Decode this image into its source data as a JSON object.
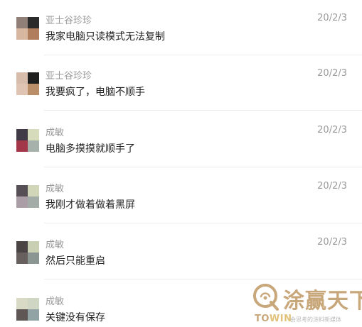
{
  "messages": [
    {
      "name": "亚士谷珍珍",
      "date": "20/2/3",
      "text": "我家电脑只读模式无法复制",
      "avatar_colors": [
        "#8f7f77",
        "#2b2b2b",
        "#d7b79f",
        "#b07e5c"
      ]
    },
    {
      "name": "亚士谷珍珍",
      "date": "20/2/3",
      "text": "我要疯了，电脑不顺手",
      "avatar_colors": [
        "#d8bcab",
        "#1e1e1e",
        "#e0c4b3",
        "#b98e68"
      ]
    },
    {
      "name": "成敏",
      "date": "20/2/3",
      "text": "电脑多摸摸就顺手了",
      "avatar_colors": [
        "#3f3a46",
        "#d6dbbc",
        "#a4364a",
        "#a7b1ac"
      ]
    },
    {
      "name": "成敏",
      "date": "20/2/3",
      "text": "我刚才做着做着黑屏",
      "avatar_colors": [
        "#565056",
        "#d1d6b8",
        "#aa9da5",
        "#a3aca7"
      ]
    },
    {
      "name": "成敏",
      "date": "20/2/3",
      "text": "然后只能重启",
      "avatar_colors": [
        "#4b4445",
        "#c9cfb2",
        "#67605f",
        "#8b9592"
      ]
    },
    {
      "name": "成敏",
      "date": "20/2/3",
      "text": "关键没有保存",
      "avatar_colors": [
        "#d8dac5",
        "#cfd6c4",
        "#5f5755",
        "#91a3a4"
      ]
    }
  ],
  "watermark": {
    "brand_text": "涂赢天下",
    "brand_latin_1": "TO",
    "brand_latin_2": "WIN",
    "tagline": "会思考的涂料新媒体",
    "color": "#c8a77a"
  }
}
